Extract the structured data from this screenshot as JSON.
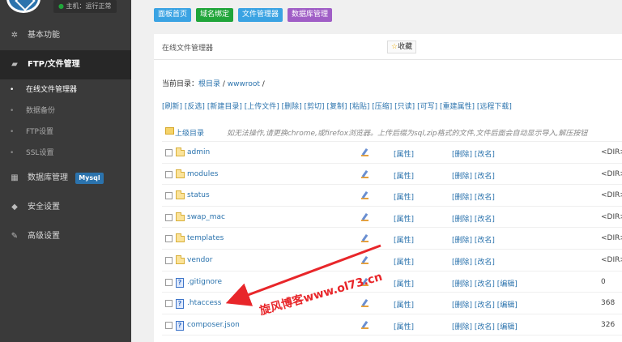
{
  "sidebar": {
    "host_status": "主机：运行正常",
    "nav": [
      {
        "label": "基本功能",
        "icon": "gamepad-icon"
      },
      {
        "label": "FTP/文件管理",
        "icon": "folder-open-icon"
      },
      {
        "label": "数据库管理",
        "icon": "table-icon",
        "badge": "Mysql"
      },
      {
        "label": "安全设置",
        "icon": "shield-icon"
      },
      {
        "label": "高级设置",
        "icon": "edit-icon"
      }
    ],
    "sub_items": [
      "在线文件管理器",
      "数据备份",
      "FTP设置",
      "SSL设置"
    ]
  },
  "tabs": [
    "面板首页",
    "域名绑定",
    "文件管理器",
    "数据库管理"
  ],
  "panel": {
    "title": "在线文件管理器",
    "favorite_label": "收藏"
  },
  "breadcrumb": {
    "prefix": "当前目录：",
    "root": "根目录",
    "sep": " / ",
    "current": "wwwroot",
    "tail": " /"
  },
  "actions": [
    "[刷新]",
    "[反选]",
    "[新建目录]",
    "[上传文件]",
    "[删除]",
    "[剪切]",
    "[复制]",
    "[粘贴]",
    "[压缩]",
    "[只读]",
    "[可写]",
    "[重建属性]",
    "[远程下载]"
  ],
  "up_row": {
    "label": "上级目录",
    "notice": "如无法操作,请更换chrome,或firefox浏览器。上传后缀为sql,zip格式的文件,文件后面会自动显示导入,解压按钮"
  },
  "files": [
    {
      "name": "admin",
      "type": "folder",
      "attr": "[属性]",
      "ops": "[删除] [改名]",
      "size": "<DIR>"
    },
    {
      "name": "modules",
      "type": "folder",
      "attr": "[属性]",
      "ops": "[删除] [改名]",
      "size": "<DIR>"
    },
    {
      "name": "status",
      "type": "folder",
      "attr": "[属性]",
      "ops": "[删除] [改名]",
      "size": "<DIR>"
    },
    {
      "name": "swap_mac",
      "type": "folder",
      "attr": "[属性]",
      "ops": "[删除] [改名]",
      "size": "<DIR>"
    },
    {
      "name": "templates",
      "type": "folder",
      "attr": "[属性]",
      "ops": "[删除] [改名]",
      "size": "<DIR>"
    },
    {
      "name": "vendor",
      "type": "folder",
      "attr": "[属性]",
      "ops": "[删除] [改名]",
      "size": "<DIR>"
    },
    {
      "name": ".gitignore",
      "type": "file",
      "attr": "[属性]",
      "ops": "[删除] [改名] [编辑]",
      "size": "0"
    },
    {
      "name": ".htaccess",
      "type": "file",
      "attr": "[属性]",
      "ops": "[删除] [改名] [编辑]",
      "size": "368"
    },
    {
      "name": "composer.json",
      "type": "file",
      "attr": "[属性]",
      "ops": "[删除] [改名] [编辑]",
      "size": "326"
    }
  ],
  "watermark": "旋风博客www.ol73.cn",
  "colors": {
    "accent_red": "#e8262a",
    "link_blue": "#2b73ad",
    "sidebar_bg": "#3a3a3a"
  }
}
